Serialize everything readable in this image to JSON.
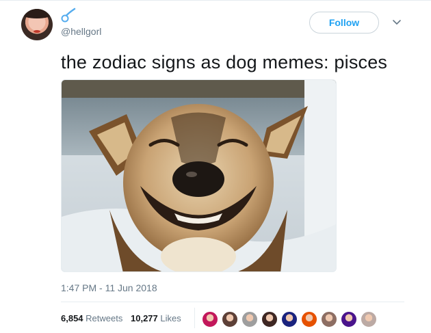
{
  "user": {
    "handle": "@hellgorl",
    "avatar_icon": "profile-avatar",
    "name_icon": "comet-emoji-icon"
  },
  "follow_label": "Follow",
  "menu_icon": "chevron-down-icon",
  "tweet": {
    "text": "the zodiac signs as dog memes: pisces"
  },
  "photo": {
    "subject": "smiling-dog-photo"
  },
  "timestamp": "1:47 PM - 11 Jun 2018",
  "stats": {
    "retweets_count": "6,854",
    "retweets_label": "Retweets",
    "likes_count": "10,277",
    "likes_label": "Likes"
  },
  "likers": [
    {
      "name": "liker-avatar-1",
      "color": "#c2185b"
    },
    {
      "name": "liker-avatar-2",
      "color": "#5d4037"
    },
    {
      "name": "liker-avatar-3",
      "color": "#9e9e9e"
    },
    {
      "name": "liker-avatar-4",
      "color": "#3e2723"
    },
    {
      "name": "liker-avatar-5",
      "color": "#1a237e"
    },
    {
      "name": "liker-avatar-6",
      "color": "#e65100"
    },
    {
      "name": "liker-avatar-7",
      "color": "#8d6e63"
    },
    {
      "name": "liker-avatar-8",
      "color": "#4a148c"
    },
    {
      "name": "liker-avatar-9",
      "color": "#bcaaa4"
    }
  ],
  "colors": {
    "accent": "#1da1f2",
    "muted": "#657786",
    "text": "#14171a"
  }
}
